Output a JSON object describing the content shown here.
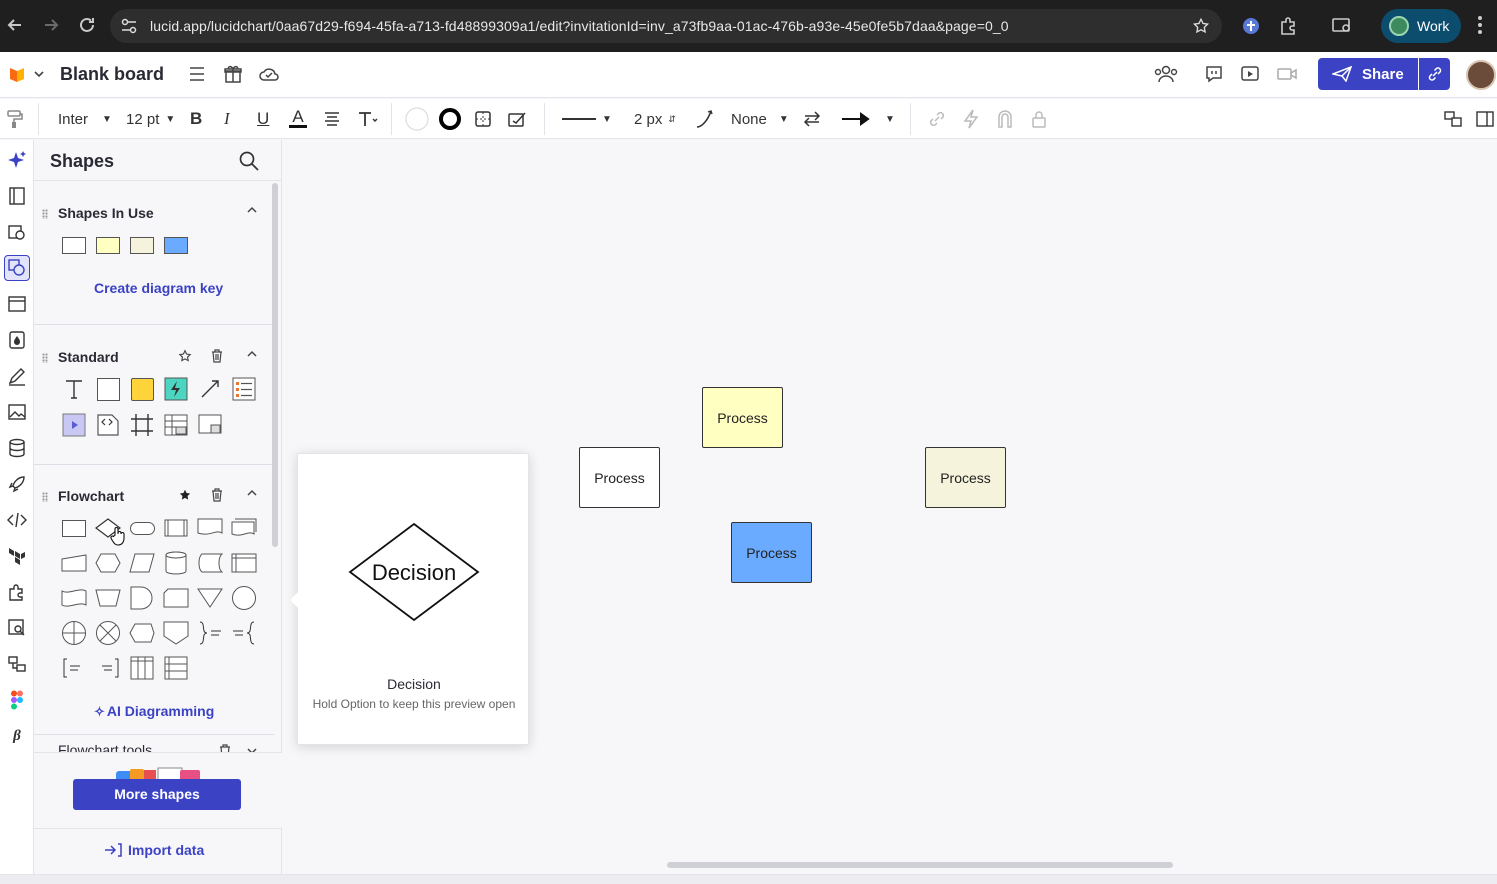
{
  "browser": {
    "url": "lucid.app/lucidchart/0aa67d29-f694-45fa-a713-fd48899309a1/edit?invitationId=inv_a73fb9aa-01ac-476b-a93e-45e0fe5b7daa&page=0_0",
    "profile_label": "Work"
  },
  "header": {
    "title": "Blank board",
    "share_label": "Share"
  },
  "toolbar": {
    "font": "Inter",
    "font_size": "12 pt",
    "bold": "B",
    "italic": "I",
    "underline": "U",
    "font_color": "A",
    "line_width": "2 px",
    "arrow_start": "None"
  },
  "shapes_panel": {
    "title": "Shapes",
    "in_use": {
      "title": "Shapes In Use",
      "create_key": "Create diagram key"
    },
    "standard": {
      "title": "Standard"
    },
    "flowchart": {
      "title": "Flowchart",
      "ai_label": "AI Diagramming"
    },
    "flowchart_tools": {
      "title": "Flowchart tools"
    },
    "more_shapes": "More shapes",
    "import_data": "Import data"
  },
  "preview": {
    "shape_text": "Decision",
    "name": "Decision",
    "hint": "Hold Option to keep this preview open"
  },
  "canvas": {
    "shapes": [
      {
        "label": "Process",
        "fill": "#ffffff"
      },
      {
        "label": "Process",
        "fill": "#ffffc2"
      },
      {
        "label": "Process",
        "fill": "#f5f3dc"
      },
      {
        "label": "Process",
        "fill": "#6aaaff"
      }
    ]
  },
  "colors": {
    "accent": "#3b42c4",
    "brand_orange": "#f96b13",
    "process_yellow": "#ffffc2",
    "process_cream": "#f5f3dc",
    "process_blue": "#6aaaff"
  }
}
